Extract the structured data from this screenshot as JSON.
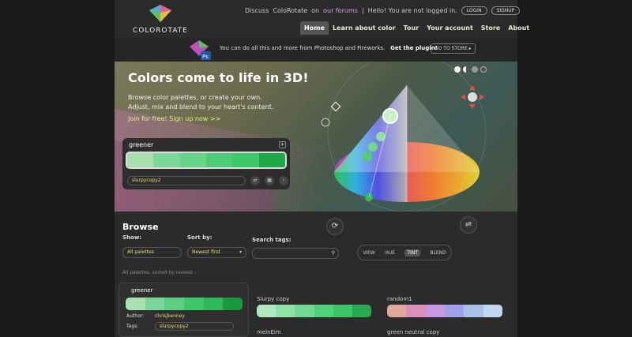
{
  "header": {
    "logo_text": "COLOROTATE",
    "discuss": "Discuss",
    "site": "ColoRotate",
    "on": "on",
    "forums": "our forums",
    "hello": "Hello! You are not logged in.",
    "login": "LOGIN",
    "signup": "SIGNUP"
  },
  "nav": [
    "Home",
    "Learn about color",
    "Tour",
    "Your account",
    "Store",
    "About"
  ],
  "promo": {
    "text": "You can do all this and more from Photoshop and Fireworks.",
    "plugin": "Get the plugin!",
    "store": "GO TO STORE"
  },
  "hero": {
    "title": "Colors come to life in 3D!",
    "sub1": "Browse color palettes, or create your own.",
    "sub2": "Adjust, mix and blend to your heart's content.",
    "join": "Join for free! Sign up now >>"
  },
  "editor_palette": {
    "name": "greener",
    "tag": "slurpycopy2",
    "colors": [
      "#a8e0b0",
      "#7cd89a",
      "#66d48a",
      "#4fcc78",
      "#3ec86c",
      "#1fa84a"
    ]
  },
  "view": {
    "label": "VIEW",
    "hue": "HUE",
    "tint": "TINT",
    "blend": "BLEND"
  },
  "browse": {
    "title": "Browse",
    "show_label": "Show:",
    "show_value": "All palettes",
    "sort_label": "Sort by:",
    "sort_value": "Newest first",
    "search_label": "Search tags:",
    "sorted_text": "All palettes, sorted by newest :"
  },
  "cards": {
    "featured": {
      "name": "greener",
      "author_label": "Author:",
      "author": "chrisjkenney",
      "tags_label": "Tags:",
      "tags": "slurpycopy2",
      "colors": [
        "#a8e0b0",
        "#7cd89a",
        "#5ad080",
        "#3ec86c",
        "#2eb85a",
        "#1a9a40"
      ]
    },
    "slurpy": {
      "name": "Slurpy copy",
      "colors": [
        "#b0e8c0",
        "#90e0a8",
        "#70d890",
        "#50d078",
        "#3cc468",
        "#28a850"
      ]
    },
    "random": {
      "name": "random1",
      "colors": [
        "#e0a898",
        "#d890b8",
        "#c898e0",
        "#a0a0e8",
        "#a8c0e8",
        "#c0d8f0"
      ]
    },
    "meinEim": {
      "name": "meinEim"
    },
    "neutral": {
      "name": "green neutral copy"
    }
  }
}
